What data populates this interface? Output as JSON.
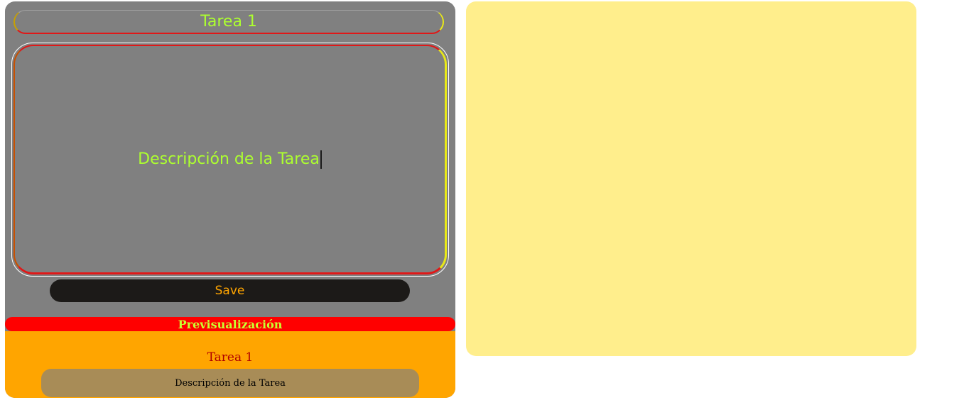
{
  "editor": {
    "title_value": "Tarea 1",
    "description_value": "Descripción de la Tarea",
    "save_label": "Save"
  },
  "preview": {
    "header": "Previsualización",
    "title": "Tarea 1",
    "description": "Descripción de la Tarea"
  },
  "colors": {
    "panel_bg": "#808080",
    "input_text": "#adff2f",
    "save_bg": "#1c1a18",
    "save_text": "#ffa500",
    "preview_header_bg": "#ff0000",
    "preview_area_bg": "#ffa500",
    "preview_desc_bg": "#a88c57",
    "right_panel_bg": "#ffee8c"
  }
}
